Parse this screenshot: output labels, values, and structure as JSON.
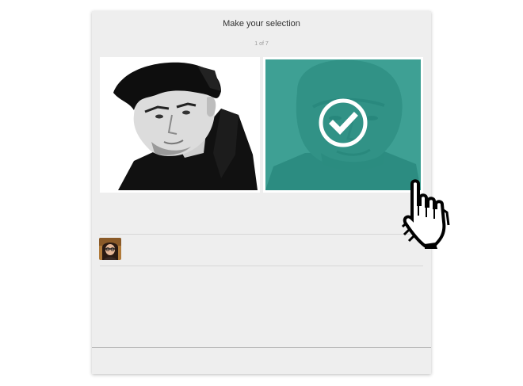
{
  "header": {
    "title": "Make your selection",
    "counter": "1 of 7"
  },
  "options": [
    {
      "name": "left-portrait",
      "selected": false
    },
    {
      "name": "right-portrait",
      "selected": true
    }
  ],
  "icons": {
    "selected_check": "check-circle-icon",
    "cursor": "hand-pointer-icon"
  },
  "colors": {
    "selection_overlay": "#2dafa0",
    "panel_background": "#eeeeee"
  }
}
